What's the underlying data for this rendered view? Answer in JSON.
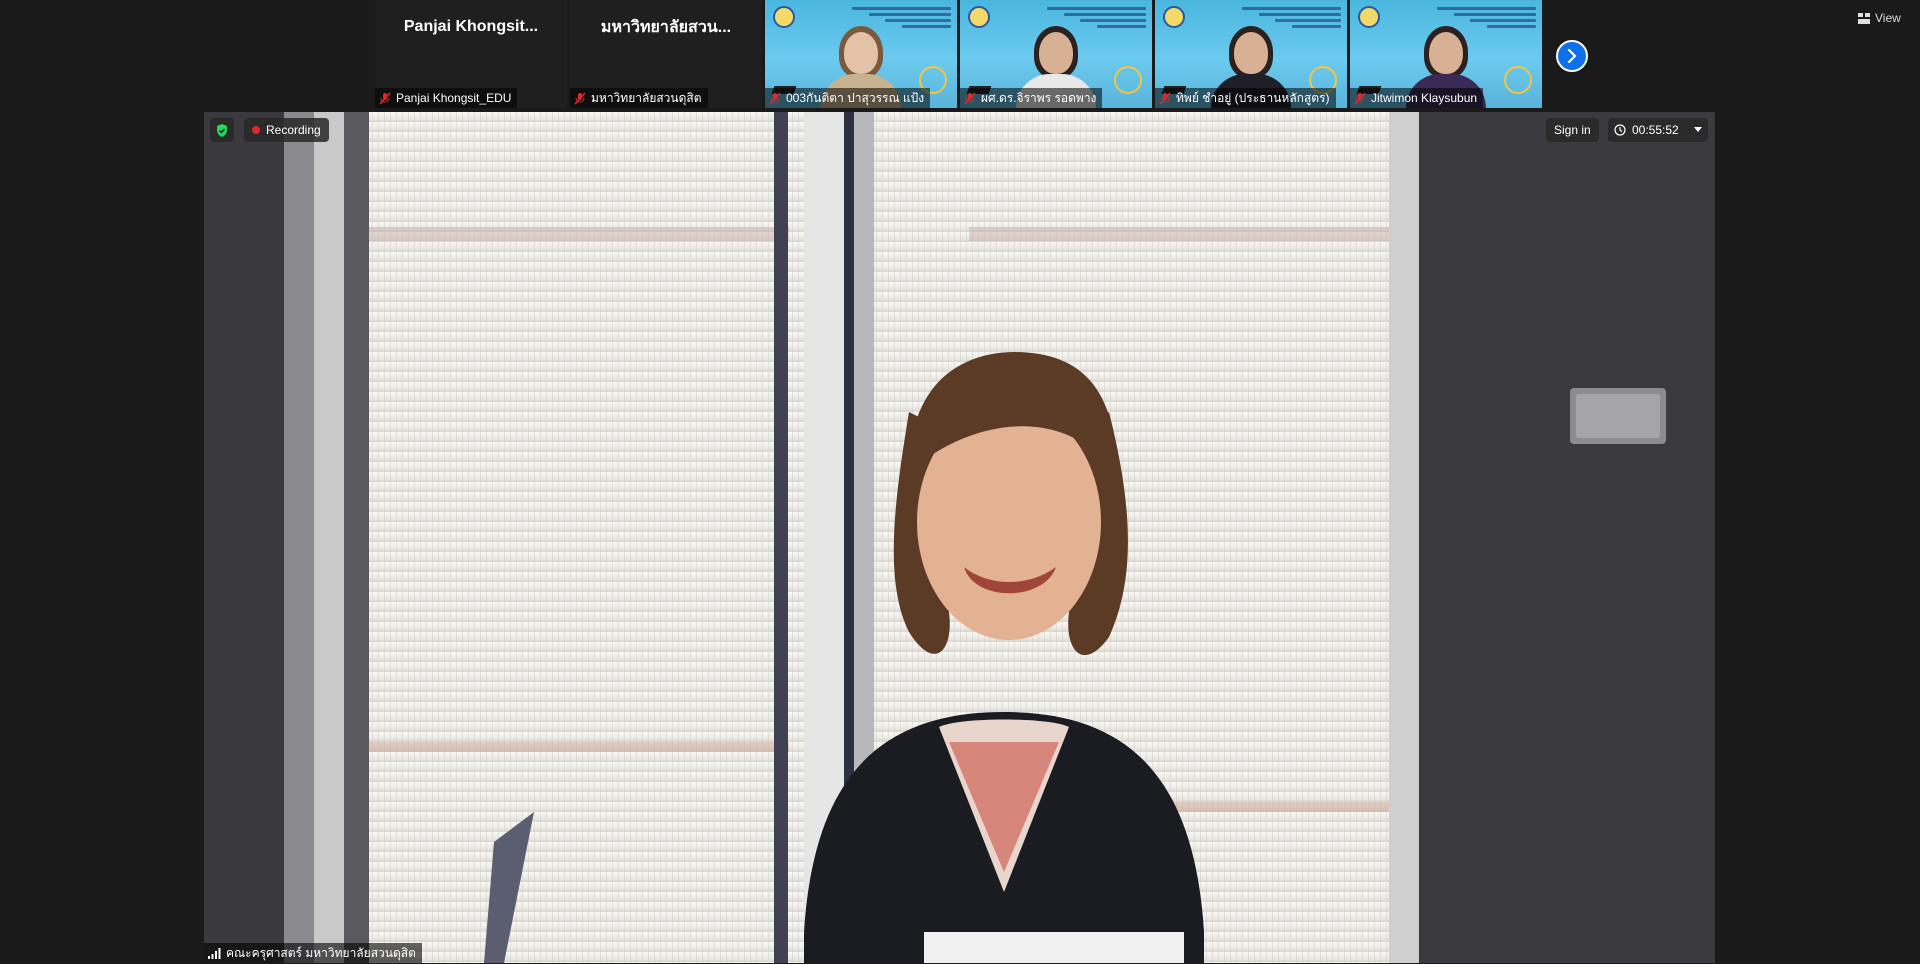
{
  "thumbnails": [
    {
      "display_name": "Panjai  Khongsit...",
      "caption": "Panjai Khongsit_EDU",
      "type": "name"
    },
    {
      "display_name": "มหาวิทยาลัยสวน...",
      "caption": "มหาวิทยาลัยสวนดุสิต",
      "type": "name"
    },
    {
      "caption": "003กันติตา ปาสุวรรณ แป้ง",
      "type": "video"
    },
    {
      "caption": "ผศ.ดร.จิราพร รอดพาง",
      "type": "video"
    },
    {
      "caption": "ทิพย์ ชำอยู่ (ประธานหลักสูตร)",
      "type": "video"
    },
    {
      "caption": "Jitwimon Klaysubun",
      "type": "video"
    }
  ],
  "top_bar": {
    "view_label": "View"
  },
  "main_video": {
    "recording_label": "Recording",
    "sign_in_label": "Sign in",
    "timer": "00:55:52",
    "speaker_name": "คณะครุศาสตร์ มหาวิทยาลัยสวนดุสิต"
  },
  "colors": {
    "accent": "#0e71eb",
    "recording": "#e02828",
    "shield": "#23d959",
    "mic_muted": "#e02828"
  }
}
